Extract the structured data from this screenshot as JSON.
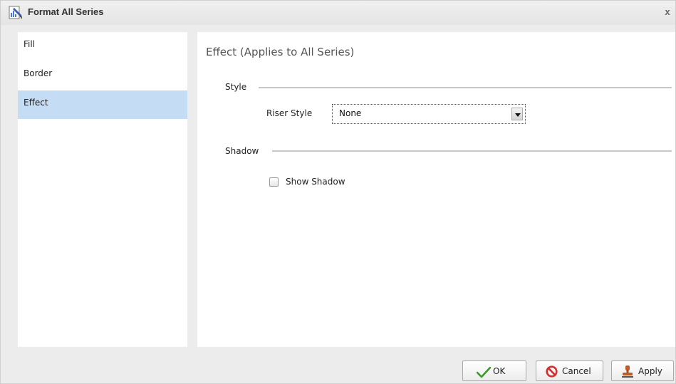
{
  "window": {
    "title": "Format All Series",
    "close_label": "x"
  },
  "nav": {
    "items": [
      {
        "label": "Fill",
        "selected": false
      },
      {
        "label": "Border",
        "selected": false
      },
      {
        "label": "Effect",
        "selected": true
      }
    ]
  },
  "content": {
    "title": "Effect (Applies to All Series)",
    "style_section": {
      "label": "Style",
      "riser_style_label": "Riser Style",
      "riser_style_value": "None"
    },
    "shadow_section": {
      "label": "Shadow",
      "show_shadow_label": "Show Shadow",
      "show_shadow_checked": false
    }
  },
  "buttons": {
    "ok_label": "OK",
    "cancel_label": "Cancel",
    "apply_label": "Apply"
  },
  "colors": {
    "selected_nav": "#c4ddf5",
    "ok_check": "#3a9b2a",
    "cancel_icon": "#d23030"
  }
}
